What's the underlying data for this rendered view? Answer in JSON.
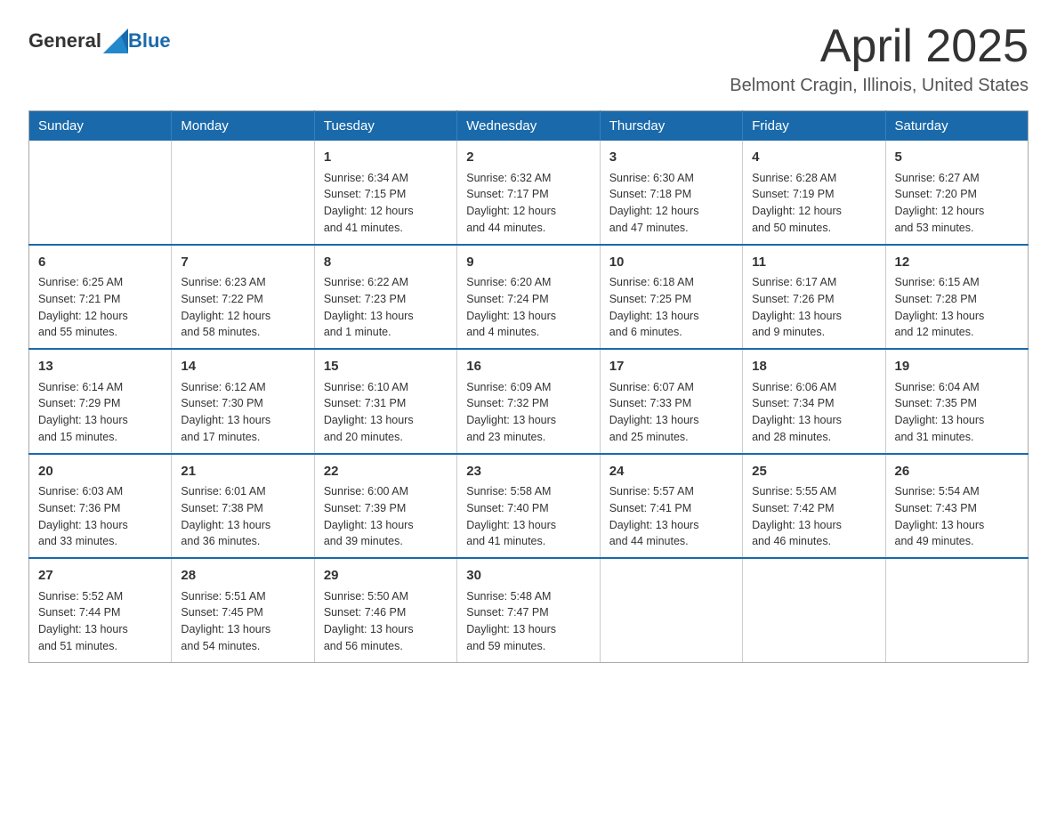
{
  "header": {
    "logo_general": "General",
    "logo_blue": "Blue",
    "month": "April 2025",
    "location": "Belmont Cragin, Illinois, United States"
  },
  "weekdays": [
    "Sunday",
    "Monday",
    "Tuesday",
    "Wednesday",
    "Thursday",
    "Friday",
    "Saturday"
  ],
  "weeks": [
    [
      {
        "day": "",
        "info": ""
      },
      {
        "day": "",
        "info": ""
      },
      {
        "day": "1",
        "info": "Sunrise: 6:34 AM\nSunset: 7:15 PM\nDaylight: 12 hours\nand 41 minutes."
      },
      {
        "day": "2",
        "info": "Sunrise: 6:32 AM\nSunset: 7:17 PM\nDaylight: 12 hours\nand 44 minutes."
      },
      {
        "day": "3",
        "info": "Sunrise: 6:30 AM\nSunset: 7:18 PM\nDaylight: 12 hours\nand 47 minutes."
      },
      {
        "day": "4",
        "info": "Sunrise: 6:28 AM\nSunset: 7:19 PM\nDaylight: 12 hours\nand 50 minutes."
      },
      {
        "day": "5",
        "info": "Sunrise: 6:27 AM\nSunset: 7:20 PM\nDaylight: 12 hours\nand 53 minutes."
      }
    ],
    [
      {
        "day": "6",
        "info": "Sunrise: 6:25 AM\nSunset: 7:21 PM\nDaylight: 12 hours\nand 55 minutes."
      },
      {
        "day": "7",
        "info": "Sunrise: 6:23 AM\nSunset: 7:22 PM\nDaylight: 12 hours\nand 58 minutes."
      },
      {
        "day": "8",
        "info": "Sunrise: 6:22 AM\nSunset: 7:23 PM\nDaylight: 13 hours\nand 1 minute."
      },
      {
        "day": "9",
        "info": "Sunrise: 6:20 AM\nSunset: 7:24 PM\nDaylight: 13 hours\nand 4 minutes."
      },
      {
        "day": "10",
        "info": "Sunrise: 6:18 AM\nSunset: 7:25 PM\nDaylight: 13 hours\nand 6 minutes."
      },
      {
        "day": "11",
        "info": "Sunrise: 6:17 AM\nSunset: 7:26 PM\nDaylight: 13 hours\nand 9 minutes."
      },
      {
        "day": "12",
        "info": "Sunrise: 6:15 AM\nSunset: 7:28 PM\nDaylight: 13 hours\nand 12 minutes."
      }
    ],
    [
      {
        "day": "13",
        "info": "Sunrise: 6:14 AM\nSunset: 7:29 PM\nDaylight: 13 hours\nand 15 minutes."
      },
      {
        "day": "14",
        "info": "Sunrise: 6:12 AM\nSunset: 7:30 PM\nDaylight: 13 hours\nand 17 minutes."
      },
      {
        "day": "15",
        "info": "Sunrise: 6:10 AM\nSunset: 7:31 PM\nDaylight: 13 hours\nand 20 minutes."
      },
      {
        "day": "16",
        "info": "Sunrise: 6:09 AM\nSunset: 7:32 PM\nDaylight: 13 hours\nand 23 minutes."
      },
      {
        "day": "17",
        "info": "Sunrise: 6:07 AM\nSunset: 7:33 PM\nDaylight: 13 hours\nand 25 minutes."
      },
      {
        "day": "18",
        "info": "Sunrise: 6:06 AM\nSunset: 7:34 PM\nDaylight: 13 hours\nand 28 minutes."
      },
      {
        "day": "19",
        "info": "Sunrise: 6:04 AM\nSunset: 7:35 PM\nDaylight: 13 hours\nand 31 minutes."
      }
    ],
    [
      {
        "day": "20",
        "info": "Sunrise: 6:03 AM\nSunset: 7:36 PM\nDaylight: 13 hours\nand 33 minutes."
      },
      {
        "day": "21",
        "info": "Sunrise: 6:01 AM\nSunset: 7:38 PM\nDaylight: 13 hours\nand 36 minutes."
      },
      {
        "day": "22",
        "info": "Sunrise: 6:00 AM\nSunset: 7:39 PM\nDaylight: 13 hours\nand 39 minutes."
      },
      {
        "day": "23",
        "info": "Sunrise: 5:58 AM\nSunset: 7:40 PM\nDaylight: 13 hours\nand 41 minutes."
      },
      {
        "day": "24",
        "info": "Sunrise: 5:57 AM\nSunset: 7:41 PM\nDaylight: 13 hours\nand 44 minutes."
      },
      {
        "day": "25",
        "info": "Sunrise: 5:55 AM\nSunset: 7:42 PM\nDaylight: 13 hours\nand 46 minutes."
      },
      {
        "day": "26",
        "info": "Sunrise: 5:54 AM\nSunset: 7:43 PM\nDaylight: 13 hours\nand 49 minutes."
      }
    ],
    [
      {
        "day": "27",
        "info": "Sunrise: 5:52 AM\nSunset: 7:44 PM\nDaylight: 13 hours\nand 51 minutes."
      },
      {
        "day": "28",
        "info": "Sunrise: 5:51 AM\nSunset: 7:45 PM\nDaylight: 13 hours\nand 54 minutes."
      },
      {
        "day": "29",
        "info": "Sunrise: 5:50 AM\nSunset: 7:46 PM\nDaylight: 13 hours\nand 56 minutes."
      },
      {
        "day": "30",
        "info": "Sunrise: 5:48 AM\nSunset: 7:47 PM\nDaylight: 13 hours\nand 59 minutes."
      },
      {
        "day": "",
        "info": ""
      },
      {
        "day": "",
        "info": ""
      },
      {
        "day": "",
        "info": ""
      }
    ]
  ]
}
